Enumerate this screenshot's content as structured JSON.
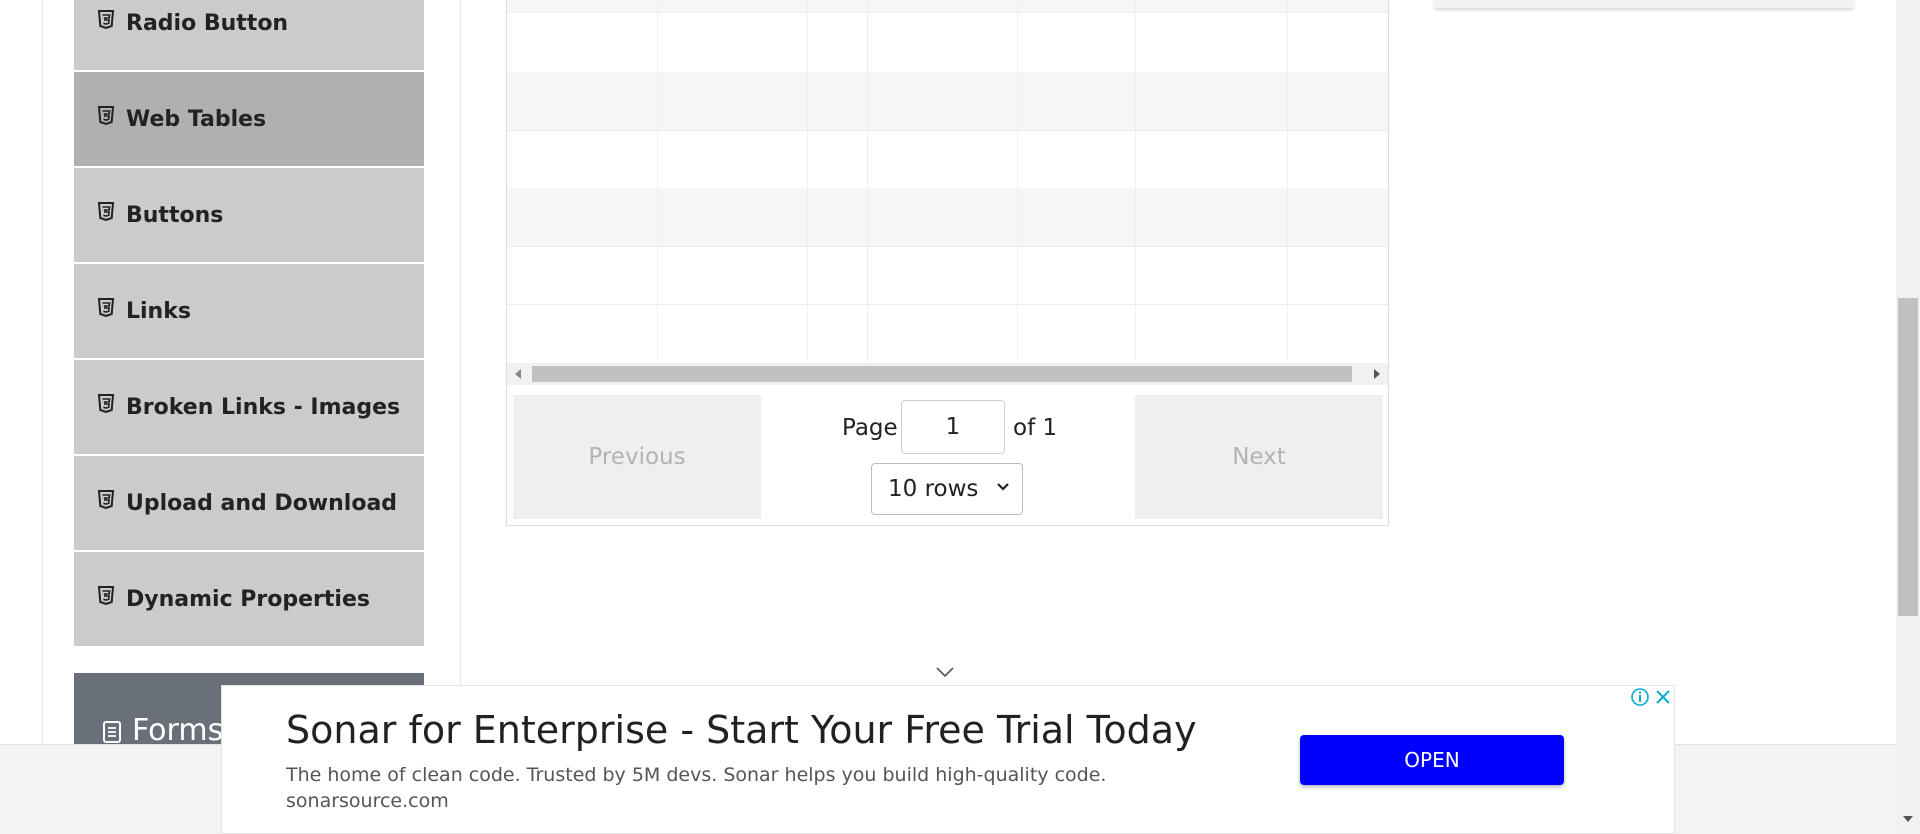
{
  "sidebar": {
    "items": [
      {
        "label": "Radio Button"
      },
      {
        "label": "Web Tables"
      },
      {
        "label": "Buttons"
      },
      {
        "label": "Links"
      },
      {
        "label": "Broken Links - Images"
      },
      {
        "label": "Upload and Download"
      },
      {
        "label": "Dynamic Properties"
      }
    ],
    "active_item": "Web Tables",
    "forms_group_label": "Forms"
  },
  "pagination": {
    "previous_label": "Previous",
    "next_label": "Next",
    "page_label": "Page",
    "page_value": "1",
    "of_label": "of 1",
    "rows_selected": "10 rows"
  },
  "ad": {
    "title": "Sonar for Enterprise - Start Your Free Trial Today",
    "description": "The home of clean code. Trusted by 5M devs. Sonar helps you build high-quality code.",
    "domain": "sonarsource.com",
    "open_label": "OPEN",
    "info_icon": "info-icon",
    "close_icon": "close-icon"
  },
  "colors": {
    "menu_bg": "#cbcbcb",
    "menu_active_bg": "#b0b0b0",
    "forms_group_bg": "#6a7079",
    "ad_button": "#0000ff",
    "ad_icon": "#00aecd"
  }
}
